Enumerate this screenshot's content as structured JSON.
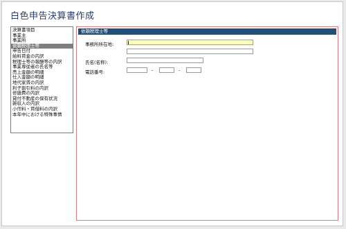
{
  "app": {
    "title": "白色申告決算書作成"
  },
  "sidebar": {
    "items": [
      {
        "label": "決算書項目"
      },
      {
        "label": "事業主"
      },
      {
        "label": "事業所"
      },
      {
        "label": "依頼税理士等",
        "selected": true
      },
      {
        "label": "申告日付"
      },
      {
        "label": "給料賃金の内訳"
      },
      {
        "label": "税理士等の報酬等の内訳"
      },
      {
        "label": "事業専従者の氏名等"
      },
      {
        "label": "売上金額の明細"
      },
      {
        "label": "仕入金額の明細"
      },
      {
        "label": "地代家賃の内訳"
      },
      {
        "label": "利子割引料の内訳"
      },
      {
        "label": "修繕費の内訳"
      },
      {
        "label": "貸付不動産の保有状況"
      },
      {
        "label": "雑収入の内訳"
      },
      {
        "label": "小作料・賃借料の内訳"
      },
      {
        "label": "本年中における特殊事情"
      }
    ]
  },
  "form": {
    "header": "依頼税理士等",
    "office_address_label": "事務所所在地:",
    "office_address_line1": "",
    "office_address_line2": "",
    "name_label": "氏名(名称):",
    "name_value": "",
    "phone_label": "電話番号:",
    "phone_part1": "",
    "phone_part2": "",
    "phone_part3": "",
    "phone_separator": "-"
  },
  "colors": {
    "title": "#2a3e6b",
    "panel_header_bg": "#1f4f7a",
    "selected_item_bg": "#7f7f7f",
    "active_field_bg": "#fdfdc0",
    "panel_border": "#d77a7a"
  }
}
